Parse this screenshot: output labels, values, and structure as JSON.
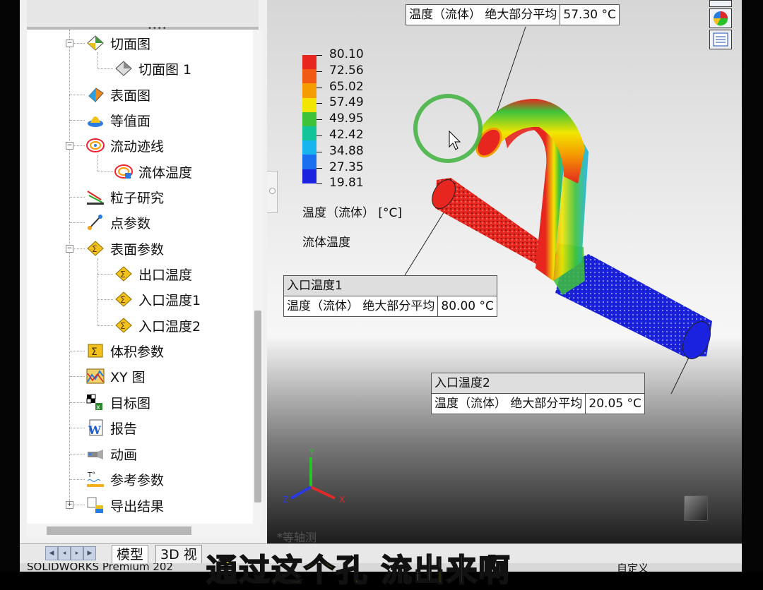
{
  "tree": {
    "items": [
      {
        "label": "切面图",
        "icon": "cut-plot-icon"
      },
      {
        "label": "切面图 1",
        "icon": "cut-plot-item-icon"
      },
      {
        "label": "表面图",
        "icon": "surface-plot-icon"
      },
      {
        "label": "等值面",
        "icon": "isosurface-icon"
      },
      {
        "label": "流动迹线",
        "icon": "flow-trajectories-icon"
      },
      {
        "label": "流体温度",
        "icon": "flow-trajectory-item-icon"
      },
      {
        "label": "粒子研究",
        "icon": "particle-study-icon"
      },
      {
        "label": "点参数",
        "icon": "point-parameters-icon"
      },
      {
        "label": "表面参数",
        "icon": "surface-parameters-icon"
      },
      {
        "label": "出口温度",
        "icon": "surface-parameter-item-icon"
      },
      {
        "label": "入口温度1",
        "icon": "surface-parameter-item-icon"
      },
      {
        "label": "入口温度2",
        "icon": "surface-parameter-item-icon"
      },
      {
        "label": "体积参数",
        "icon": "volume-parameters-icon"
      },
      {
        "label": "XY 图",
        "icon": "xy-plot-icon"
      },
      {
        "label": "目标图",
        "icon": "goal-plot-icon"
      },
      {
        "label": "报告",
        "icon": "report-icon"
      },
      {
        "label": "动画",
        "icon": "animation-icon"
      },
      {
        "label": "参考参数",
        "icon": "reference-parameters-icon"
      },
      {
        "label": "导出结果",
        "icon": "export-results-icon"
      }
    ],
    "expanders": {
      "collapse": "−",
      "expand": "+"
    }
  },
  "tabs": {
    "model": "模型",
    "view3d": "3D 视"
  },
  "status": {
    "left": "SOLIDWORKS Premium 202",
    "right": "自定义"
  },
  "legend": {
    "values": [
      "80.10",
      "72.56",
      "65.02",
      "57.49",
      "49.95",
      "42.42",
      "34.88",
      "27.35",
      "19.81"
    ],
    "colors": [
      "#e6261f",
      "#f05a12",
      "#f59d00",
      "#f2e600",
      "#3ec23a",
      "#12c49a",
      "#18b4f0",
      "#1a6ef0",
      "#1a22e0"
    ],
    "title": "温度（流体） [°C]",
    "subtitle": "流体温度"
  },
  "callouts": {
    "outlet": {
      "param": "温度（流体） 绝大部分平均",
      "value": "57.30 °C"
    },
    "inlet1": {
      "title": "入口温度1",
      "param": "温度（流体） 绝大部分平均",
      "value": "80.00 °C"
    },
    "inlet2": {
      "title": "入口温度2",
      "param": "温度（流体） 绝大部分平均",
      "value": "20.05 °C"
    }
  },
  "triad": {
    "x": "X",
    "y": "Y",
    "z": "Z"
  },
  "view_label": "*等轴测",
  "caption": "通过这个孔 流出来啊",
  "colors": {
    "hot": "#e6261f",
    "cold": "#1a22e0",
    "caption": "#ffe600"
  }
}
